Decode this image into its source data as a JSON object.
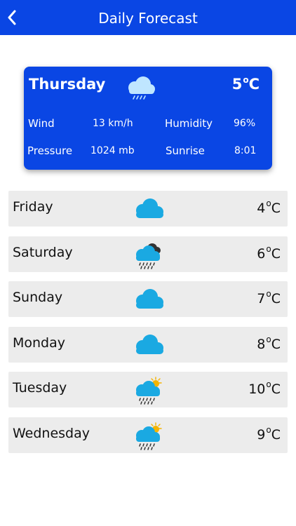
{
  "header": {
    "title": "Daily Forecast"
  },
  "today": {
    "day": "Thursday",
    "temp": "5",
    "degree_symbol": "o",
    "unit": "C",
    "icon": "cloud-rain-icon",
    "wind_label": "Wind",
    "wind_value": "13 km/h",
    "humidity_label": "Humidity",
    "humidity_value": "96%",
    "pressure_label": "Pressure",
    "pressure_value": "1024 mb",
    "sunrise_label": "Sunrise",
    "sunrise_value": "8:01"
  },
  "forecast": [
    {
      "day": "Friday",
      "temp": "4",
      "icon": "cloud-icon"
    },
    {
      "day": "Saturday",
      "temp": "6",
      "icon": "storm-rain-icon"
    },
    {
      "day": "Sunday",
      "temp": "7",
      "icon": "cloud-icon"
    },
    {
      "day": "Monday",
      "temp": "8",
      "icon": "cloud-icon"
    },
    {
      "day": "Tuesday",
      "temp": "10",
      "icon": "sun-rain-icon"
    },
    {
      "day": "Wednesday",
      "temp": "9",
      "icon": "sun-rain-icon"
    }
  ],
  "colors": {
    "primary": "#0a46e4",
    "row_bg": "#ececec",
    "cloud": "#1aa9e2"
  }
}
